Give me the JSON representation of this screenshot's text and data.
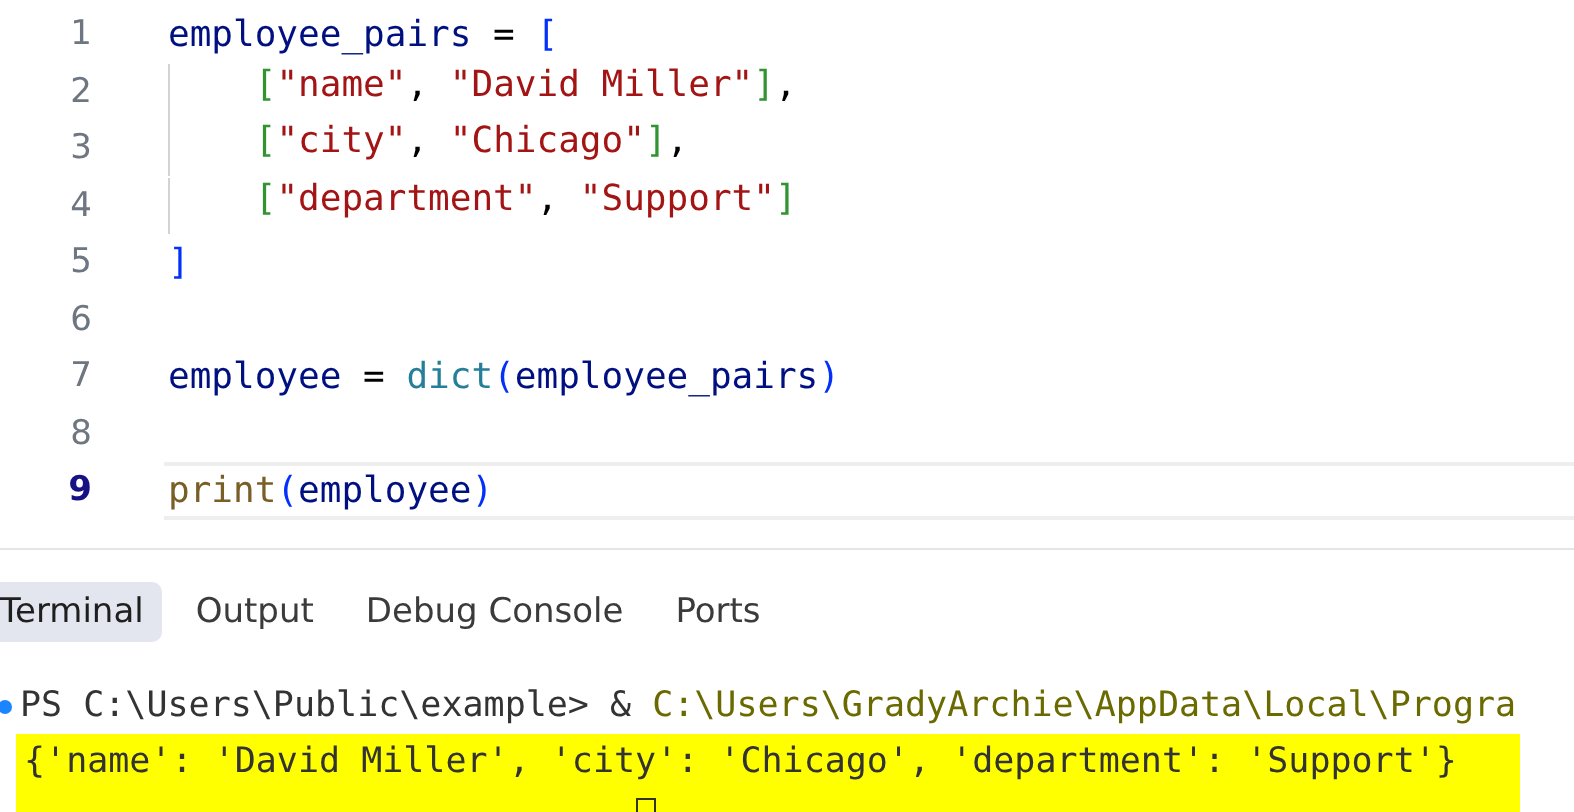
{
  "editor": {
    "lines": [
      {
        "number": "1",
        "current": false,
        "tokens": [
          {
            "text": "employee_pairs",
            "kind": "var"
          },
          {
            "text": " = ",
            "kind": "op"
          },
          {
            "text": "[",
            "kind": "bracket1"
          }
        ],
        "children": [
          {
            "number": "2",
            "current": false,
            "tokens": [
              {
                "text": "[",
                "kind": "bracket2"
              },
              {
                "text": "\"name\"",
                "kind": "string"
              },
              {
                "text": ", ",
                "kind": "op"
              },
              {
                "text": "\"David Miller\"",
                "kind": "string"
              },
              {
                "text": "]",
                "kind": "bracket2"
              },
              {
                "text": ",",
                "kind": "op"
              }
            ]
          },
          {
            "number": "3",
            "current": false,
            "tokens": [
              {
                "text": "[",
                "kind": "bracket2"
              },
              {
                "text": "\"city\"",
                "kind": "string"
              },
              {
                "text": ", ",
                "kind": "op"
              },
              {
                "text": "\"Chicago\"",
                "kind": "string"
              },
              {
                "text": "]",
                "kind": "bracket2"
              },
              {
                "text": ",",
                "kind": "op"
              }
            ]
          },
          {
            "number": "4",
            "current": false,
            "tokens": [
              {
                "text": "[",
                "kind": "bracket2"
              },
              {
                "text": "\"department\"",
                "kind": "string"
              },
              {
                "text": ", ",
                "kind": "op"
              },
              {
                "text": "\"Support\"",
                "kind": "string"
              },
              {
                "text": "]",
                "kind": "bracket2"
              }
            ]
          }
        ]
      },
      {
        "number": "5",
        "current": false,
        "tokens": [
          {
            "text": "]",
            "kind": "bracket1"
          }
        ]
      },
      {
        "number": "6",
        "current": false
      },
      {
        "number": "7",
        "current": false,
        "tokens": [
          {
            "text": "employee",
            "kind": "var"
          },
          {
            "text": " = ",
            "kind": "op"
          },
          {
            "text": "dict",
            "kind": "type"
          },
          {
            "text": "(",
            "kind": "bracket1"
          },
          {
            "text": "employee_pairs",
            "kind": "var"
          },
          {
            "text": ")",
            "kind": "bracket1"
          }
        ]
      },
      {
        "number": "8",
        "current": false
      },
      {
        "number": "9",
        "current": true,
        "tokens": [
          {
            "text": "print",
            "kind": "func"
          },
          {
            "text": "(",
            "kind": "bracket1"
          },
          {
            "text": "employee",
            "kind": "var"
          },
          {
            "text": ")",
            "kind": "bracket1"
          }
        ]
      }
    ]
  },
  "panel": {
    "tabs": [
      {
        "label": "Terminal",
        "selected": true
      },
      {
        "label": "Output",
        "selected": false
      },
      {
        "label": "Debug Console",
        "selected": false
      },
      {
        "label": "Ports",
        "selected": false
      }
    ],
    "terminal": {
      "prompt": "PS C:\\Users\\Public\\example> & ",
      "command": "C:\\Users\\GradyArchie\\AppData\\Local\\Progra",
      "output": "{'name': 'David Miller', 'city': 'Chicago', 'department': 'Support'}"
    }
  }
}
